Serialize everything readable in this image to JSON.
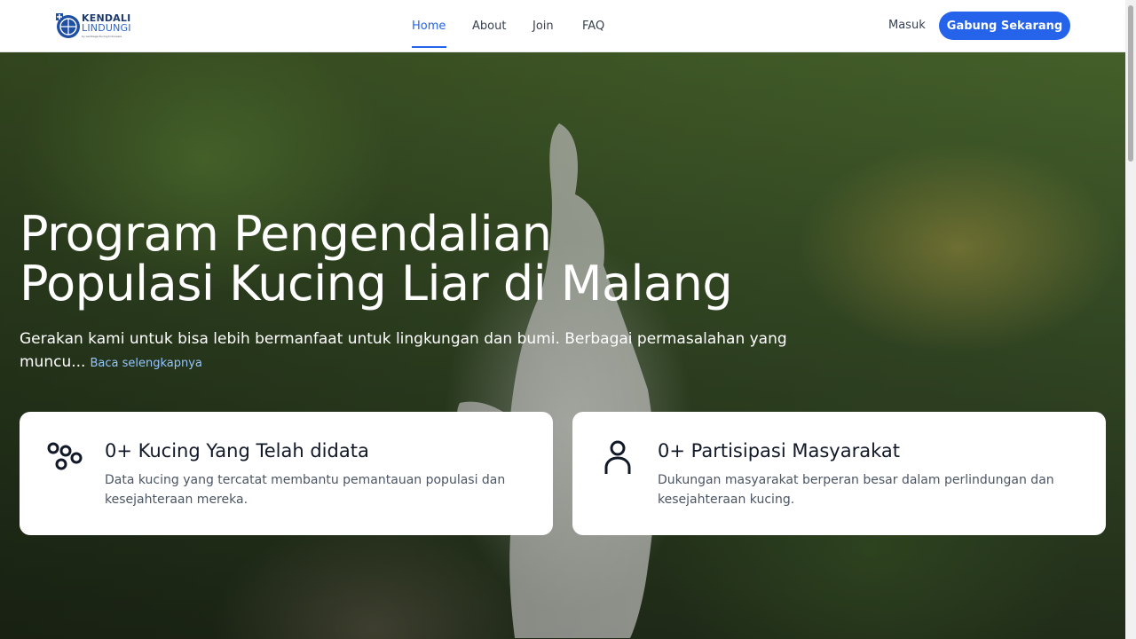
{
  "brand": {
    "line1": "KENDALI",
    "line2": "LINDUNGI",
    "tagline": "by Lembaga Kucing Indonesia"
  },
  "nav": {
    "items": [
      {
        "label": "Home",
        "active": true
      },
      {
        "label": "About",
        "active": false
      },
      {
        "label": "Join",
        "active": false
      },
      {
        "label": "FAQ",
        "active": false
      }
    ],
    "login_label": "Masuk",
    "cta_label": "Gabung Sekarang"
  },
  "hero": {
    "title_line1": "Program Pengendalian",
    "title_line2": "Populasi Kucing Liar di Malang",
    "description": "Gerakan kami untuk bisa lebih bermanfaat untuk lingkungan dan bumi. Berbagai permasalahan yang muncu...",
    "read_more": "Baca selengkapnya"
  },
  "stats": [
    {
      "icon": "paw-icon",
      "title": "0+ Kucing Yang Telah didata",
      "description": "Data kucing yang tercatat membantu pemantauan populasi dan kesejahteraan mereka."
    },
    {
      "icon": "person-icon",
      "title": "0+ Partisipasi Masyarakat",
      "description": "Dukungan masyarakat berperan besar dalam perlindungan dan kesejahteraan kucing."
    }
  ],
  "colors": {
    "primary": "#2563eb",
    "text_dark": "#111827",
    "text_muted": "#4b5563",
    "link_light": "#93c5fd"
  }
}
